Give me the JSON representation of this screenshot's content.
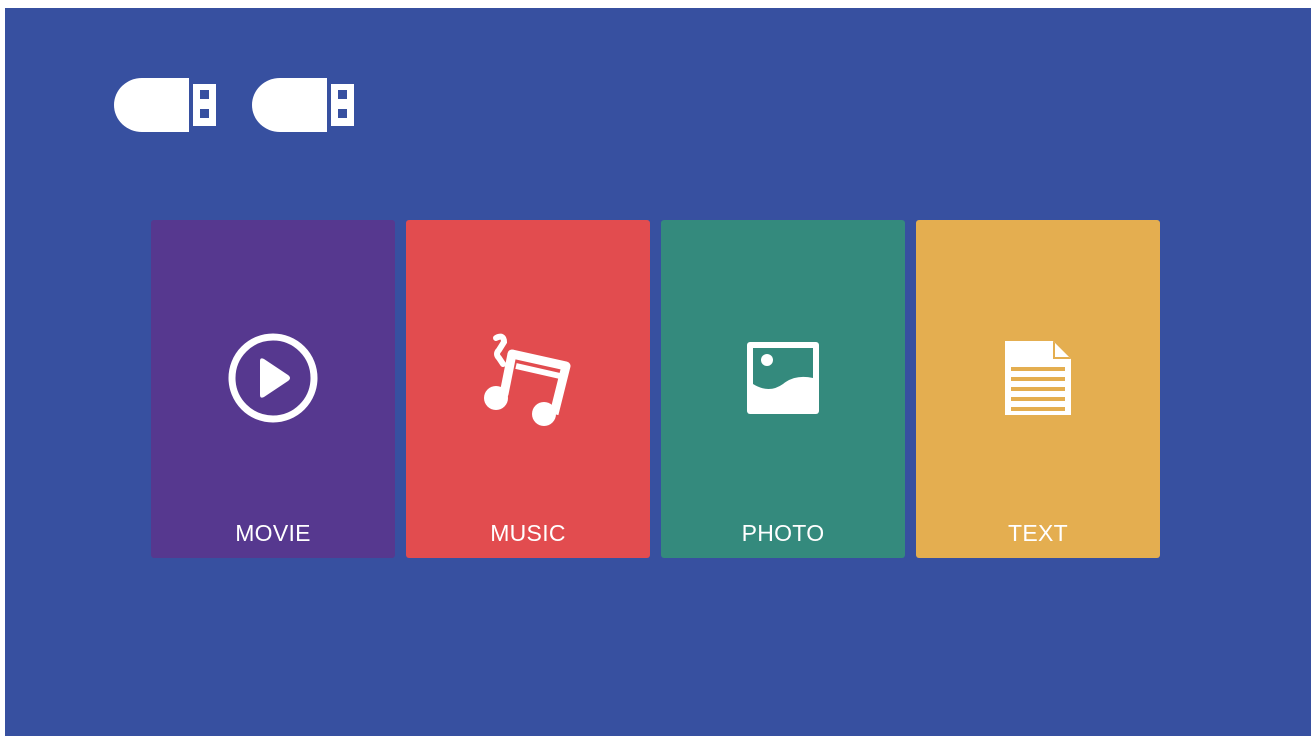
{
  "colors": {
    "background": "#3750a0",
    "movie": "#56388f",
    "music": "#e24c4f",
    "photo": "#348a7d",
    "text": "#e4ae50",
    "icon": "#ffffff"
  },
  "devices": [
    {
      "icon": "usb-drive-icon"
    },
    {
      "icon": "usb-drive-icon"
    }
  ],
  "tiles": [
    {
      "label": "MOVIE",
      "icon": "play-circle-icon"
    },
    {
      "label": "MUSIC",
      "icon": "music-note-icon"
    },
    {
      "label": "PHOTO",
      "icon": "photo-icon"
    },
    {
      "label": "TEXT",
      "icon": "document-icon"
    }
  ]
}
